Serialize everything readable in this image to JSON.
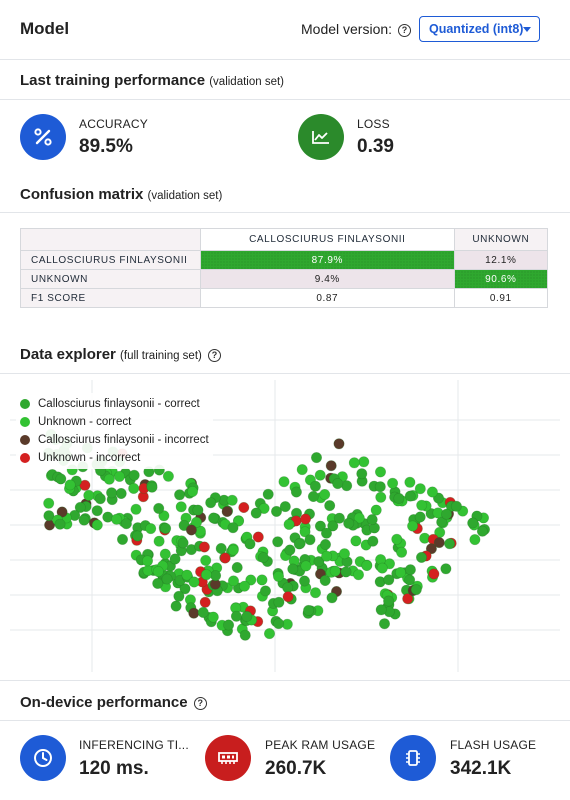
{
  "header": {
    "title": "Model",
    "model_version_label": "Model version:",
    "model_version_value": "Quantized (int8)"
  },
  "training": {
    "title": "Last training performance",
    "note": "(validation set)",
    "accuracy_label": "ACCURACY",
    "accuracy_value": "89.5%",
    "loss_label": "LOSS",
    "loss_value": "0.39"
  },
  "confusion": {
    "title": "Confusion matrix",
    "note": "(validation set)",
    "columns": [
      "CALLOSCIURUS FINLAYSONII",
      "UNKNOWN"
    ],
    "rows": [
      {
        "label": "CALLOSCIURUS FINLAYSONII",
        "cells": [
          "87.9%",
          "12.1%"
        ]
      },
      {
        "label": "UNKNOWN",
        "cells": [
          "9.4%",
          "90.6%"
        ]
      },
      {
        "label": "F1 SCORE",
        "cells": [
          "0.87",
          "0.91"
        ]
      }
    ]
  },
  "explorer": {
    "title": "Data explorer",
    "note": "(full training set)",
    "legend": [
      {
        "label": "Callosciurus finlaysonii - correct",
        "color": "#2fa82f"
      },
      {
        "label": "Unknown - correct",
        "color": "#33c233"
      },
      {
        "label": "Callosciurus finlaysonii - incorrect",
        "color": "#5a3a2a"
      },
      {
        "label": "Unknown - incorrect",
        "color": "#d42020"
      }
    ]
  },
  "ondevice": {
    "title": "On-device performance",
    "inferencing_label": "INFERENCING TI...",
    "inferencing_value": "120 ms.",
    "ram_label": "PEAK RAM USAGE",
    "ram_value": "260.7K",
    "flash_label": "FLASH USAGE",
    "flash_value": "342.1K"
  },
  "colors": {
    "accent_blue": "#1e5bd6",
    "accuracy_icon": "#1e5bd6",
    "loss_icon": "#2b8a2b",
    "ram_icon": "#c81e1e"
  },
  "icons": {
    "accuracy": "percent-icon",
    "loss": "line-chart-icon",
    "inferencing": "clock-icon",
    "ram": "memory-icon",
    "flash": "chip-icon"
  }
}
